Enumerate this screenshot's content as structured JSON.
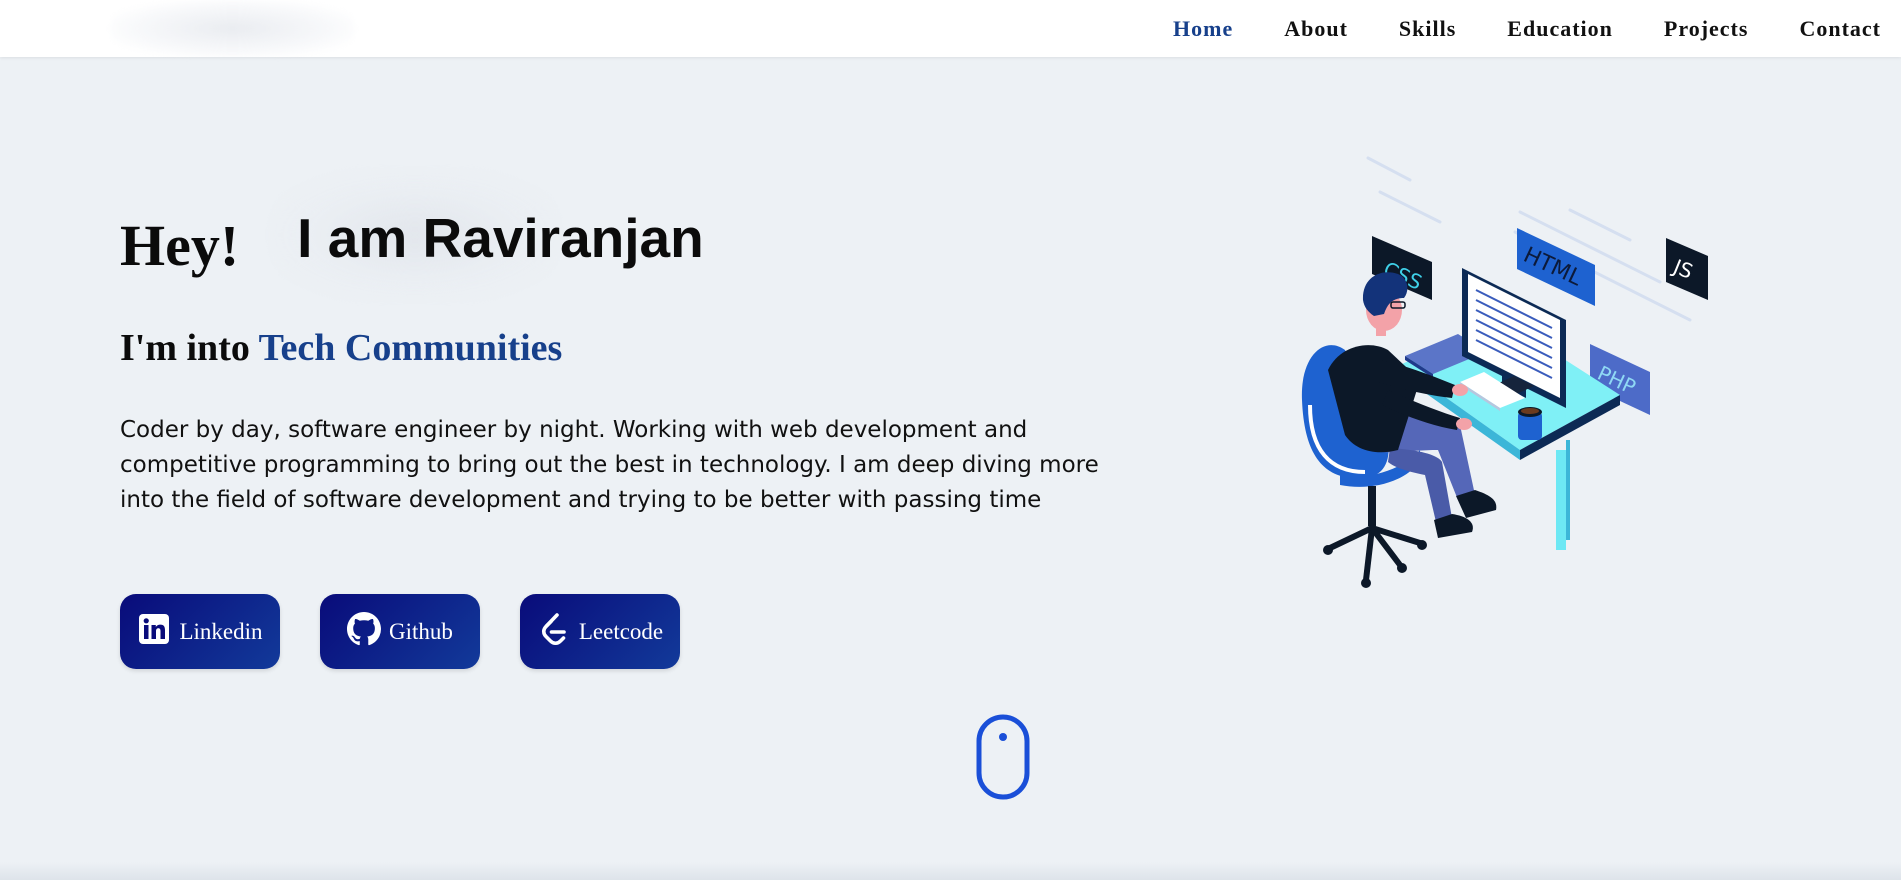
{
  "nav": {
    "links": [
      {
        "label": "Home",
        "active": true
      },
      {
        "label": "About",
        "active": false
      },
      {
        "label": "Skills",
        "active": false
      },
      {
        "label": "Education",
        "active": false
      },
      {
        "label": "Projects",
        "active": false
      },
      {
        "label": "Contact",
        "active": false
      }
    ]
  },
  "hero": {
    "greeting": "Hey!",
    "name": "I am Raviranjan",
    "subtitle_prefix": "I'm into ",
    "subtitle_highlight": "Tech Communities",
    "description": "Coder by day, software engineer by night. Working with web development and competitive programming to bring out the best in technology. I am deep diving more into the field of software development and trying to be better with passing time"
  },
  "social": {
    "buttons": [
      {
        "label": "Linkedin",
        "icon": "linkedin-icon"
      },
      {
        "label": "Github",
        "icon": "github-icon"
      },
      {
        "label": "Leetcode",
        "icon": "leetcode-icon"
      }
    ]
  },
  "illustration": {
    "tags": [
      "CSS",
      "HTML",
      "JS",
      "PHP"
    ]
  },
  "colors": {
    "accent": "#17408b",
    "button": "#090b7a",
    "background": "#edf1f5",
    "scroll_icon": "#1a4fd8"
  }
}
